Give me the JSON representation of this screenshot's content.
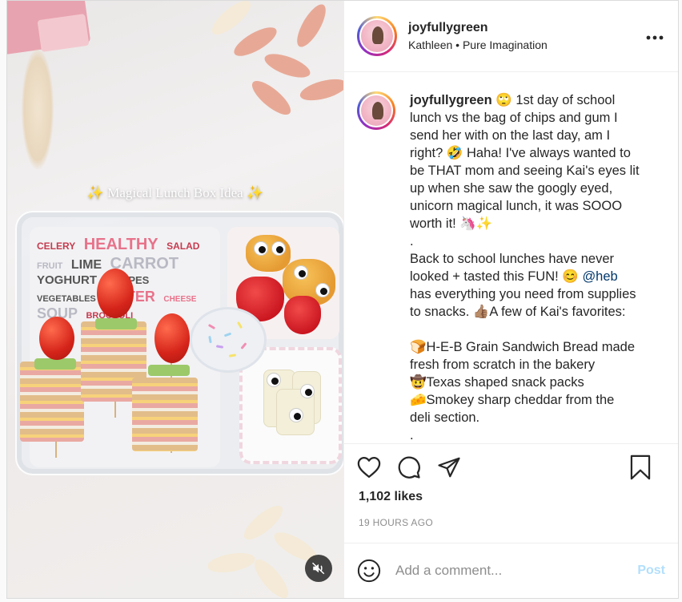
{
  "media": {
    "overlay_caption": "✨ Magical Lunch Box Idea ✨",
    "napkin_words": [
      "CELERY",
      "HEALTHY",
      "SALAD",
      "FRUIT",
      "LIME",
      "CARROT",
      "YOGHURT",
      "GRAPES",
      "VEGETABLES",
      "WATER",
      "CHEESE",
      "SOUP",
      "BROCCOLI"
    ],
    "mute_icon": "speaker-muted-icon"
  },
  "header": {
    "username": "joyfullygreen",
    "subtitle": "Kathleen • Pure Imagination",
    "more_icon": "•••"
  },
  "caption": {
    "username": "joyfullygreen",
    "lines": [
      "🙄 1st day of school",
      "lunch vs the bag of chips and gum I",
      "send her with on the last day, am I",
      "right? 🤣 Haha! I've always wanted to",
      "be THAT mom and seeing Kai's eyes lit",
      "up when she saw the googly eyed,",
      "unicorn magical lunch, it was SOOO",
      "worth it! 🦄✨",
      ".",
      "Back to school lunches have never",
      "looked + tasted this FUN! 😊",
      "has everything you need from supplies",
      "to snacks. 👍🏽A few of Kai's favorites:",
      "",
      "🍞H-E-B Grain Sandwich Bread made",
      "fresh from scratch in the bakery",
      "🤠Texas shaped snack packs",
      "🧀Smokey sharp cheddar from the",
      "deli section.",
      "."
    ],
    "mention": "@heb"
  },
  "actions": {
    "like_icon": "heart-icon",
    "comment_icon": "comment-icon",
    "share_icon": "share-icon",
    "save_icon": "bookmark-icon"
  },
  "likes": "1,102 likes",
  "timestamp": "19 HOURS AGO",
  "comment": {
    "placeholder": "Add a comment...",
    "post_label": "Post"
  },
  "colors": {
    "link": "#00376b",
    "post_button": "#b2dffc",
    "muted_text": "#8e8e8e"
  }
}
